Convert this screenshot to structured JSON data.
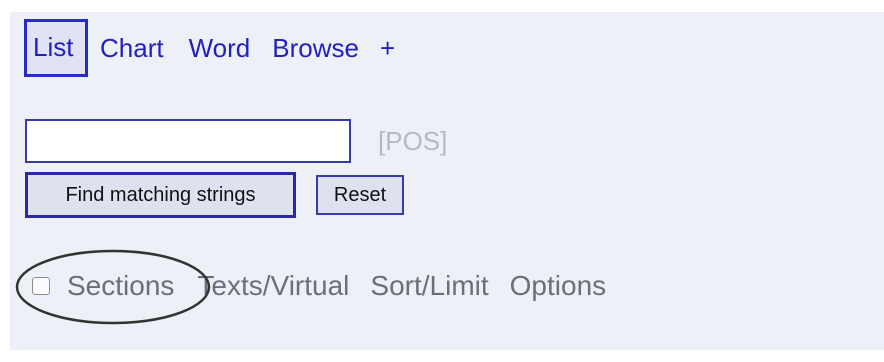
{
  "tabs": [
    {
      "label": "List",
      "active": true
    },
    {
      "label": "Chart",
      "active": false
    },
    {
      "label": "Word",
      "active": false
    },
    {
      "label": "Browse",
      "active": false
    },
    {
      "label": "+",
      "active": false
    }
  ],
  "search": {
    "value": "",
    "placeholder": ""
  },
  "pos_label": "[POS]",
  "buttons": {
    "find_label": "Find matching strings",
    "reset_label": "Reset"
  },
  "options": {
    "sections_label": "Sections",
    "sections_checked": false,
    "texts_label": "Texts/Virtual",
    "sort_label": "Sort/Limit",
    "options_label": "Options"
  },
  "colors": {
    "panel_bg": "#eef0f8",
    "link": "#2222bb",
    "active_border": "#2a2acc",
    "muted_text": "#6b6f7c",
    "pos_text": "#b5b8c6",
    "annotation": "#333333"
  }
}
